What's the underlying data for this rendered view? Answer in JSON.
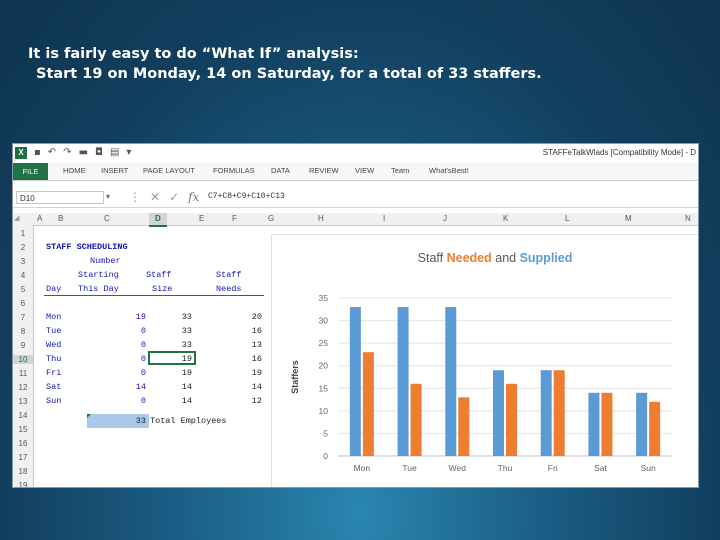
{
  "caption": {
    "line1": "It is fairly easy to do “What If” analysis:",
    "line2": "Start 19 on Monday, 14 on Saturday, for a total of 33 staffers."
  },
  "window": {
    "title": "STAFFeTalkWlads  [Compatibility Mode] - D",
    "qat_icons": [
      "excel-icon",
      "save-icon",
      "undo-icon",
      "redo-icon",
      "folder-icon",
      "camera-icon",
      "print-icon"
    ]
  },
  "ribbon": {
    "tabs": [
      "FILE",
      "HOME",
      "INSERT",
      "PAGE LAYOUT",
      "FORMULAS",
      "DATA",
      "REVIEW",
      "VIEW",
      "Team",
      "What'sBest!"
    ]
  },
  "formula_bar": {
    "name_box": "D10",
    "formula": "C7+C8+C9+C10+C13"
  },
  "columns": [
    "A",
    "B",
    "C",
    "D",
    "E",
    "F",
    "G",
    "H",
    "I",
    "J",
    "K",
    "L",
    "M",
    "N"
  ],
  "rows": [
    "1",
    "2",
    "3",
    "4",
    "5",
    "6",
    "7",
    "8",
    "9",
    "10",
    "11",
    "12",
    "13",
    "14",
    "15",
    "16",
    "17",
    "18",
    "19"
  ],
  "sheet": {
    "title": "STAFF SCHEDULING",
    "header_row3": [
      "Number"
    ],
    "header_row4": [
      "Starting",
      "Staff",
      "Staff"
    ],
    "header_row5": [
      "Day",
      "This Day",
      "Size",
      "Needs"
    ],
    "table": [
      {
        "day": "Mon",
        "start": "19",
        "size": "33",
        "needs": "20"
      },
      {
        "day": "Tue",
        "start": "0",
        "size": "33",
        "needs": "16"
      },
      {
        "day": "Wed",
        "start": "0",
        "size": "33",
        "needs": "13"
      },
      {
        "day": "Thu",
        "start": "0",
        "size": "19",
        "needs": "16"
      },
      {
        "day": "Fri",
        "start": "0",
        "size": "19",
        "needs": "19"
      },
      {
        "day": "Sat",
        "start": "14",
        "size": "14",
        "needs": "14"
      },
      {
        "day": "Sun",
        "start": "0",
        "size": "14",
        "needs": "12"
      }
    ],
    "total_value": "33",
    "total_label": "Total Employees"
  },
  "chart_data": {
    "type": "bar",
    "title_parts": [
      {
        "text": "Staff ",
        "color": "#595959"
      },
      {
        "text": "Needed",
        "color": "#ed7d31"
      },
      {
        "text": " and ",
        "color": "#595959"
      },
      {
        "text": "Supplied",
        "color": "#5b9bd5"
      }
    ],
    "ylabel": "Staffers",
    "categories": [
      "Mon",
      "Tue",
      "Wed",
      "Thu",
      "Fri",
      "Sat",
      "Sun"
    ],
    "series": [
      {
        "values": [
          33,
          33,
          33,
          19,
          19,
          14,
          14
        ],
        "color": "#5b9bd5"
      },
      {
        "values": [
          23,
          16,
          13,
          16,
          19,
          14,
          12
        ],
        "color": "#ed7d31"
      }
    ],
    "ylim": [
      0,
      35
    ],
    "yticks": [
      0,
      5,
      10,
      15,
      20,
      25,
      30,
      35
    ],
    "grid": true
  }
}
